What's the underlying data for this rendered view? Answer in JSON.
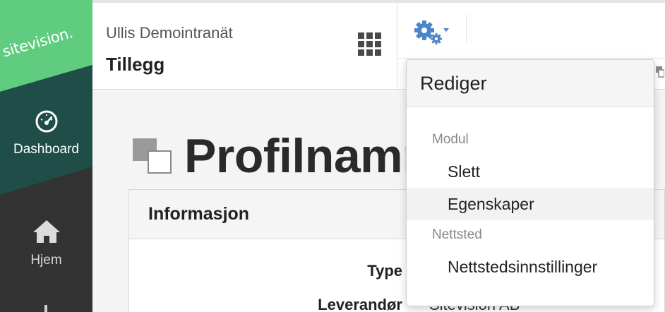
{
  "sidebar": {
    "logo": "sitevision.",
    "items": [
      {
        "label": "Dashboard",
        "icon": "gauge-icon"
      },
      {
        "label": "Hjem",
        "icon": "home-icon"
      }
    ]
  },
  "header": {
    "site_name": "Ullis Demointranät",
    "page_name": "Tillegg"
  },
  "main": {
    "title": "Profilnamn",
    "panel": {
      "heading": "Informasjon",
      "fields": [
        {
          "label": "Type",
          "value": ""
        },
        {
          "label": "Leverandør",
          "value": "Sitevision AB"
        }
      ]
    }
  },
  "dropdown": {
    "heading": "Rediger",
    "sections": [
      {
        "label": "Modul",
        "items": [
          "Slett",
          "Egenskaper"
        ]
      },
      {
        "label": "Nettsted",
        "items": [
          "Nettstedsinnstillinger"
        ]
      }
    ],
    "hovered_item": "Egenskaper"
  },
  "colors": {
    "brand_green": "#5fcc7f",
    "sidebar_teal": "#1f4e48",
    "sidebar_dark": "#333333",
    "gear_blue": "#4a86c8"
  }
}
